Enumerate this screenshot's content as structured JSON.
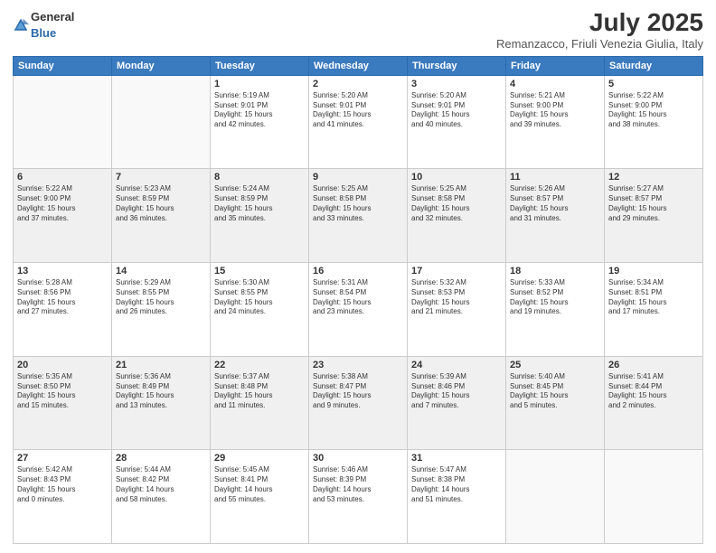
{
  "logo": {
    "general": "General",
    "blue": "Blue"
  },
  "header": {
    "month": "July 2025",
    "location": "Remanzacco, Friuli Venezia Giulia, Italy"
  },
  "weekdays": [
    "Sunday",
    "Monday",
    "Tuesday",
    "Wednesday",
    "Thursday",
    "Friday",
    "Saturday"
  ],
  "weeks": [
    [
      {
        "day": "",
        "info": ""
      },
      {
        "day": "",
        "info": ""
      },
      {
        "day": "1",
        "info": "Sunrise: 5:19 AM\nSunset: 9:01 PM\nDaylight: 15 hours\nand 42 minutes."
      },
      {
        "day": "2",
        "info": "Sunrise: 5:20 AM\nSunset: 9:01 PM\nDaylight: 15 hours\nand 41 minutes."
      },
      {
        "day": "3",
        "info": "Sunrise: 5:20 AM\nSunset: 9:01 PM\nDaylight: 15 hours\nand 40 minutes."
      },
      {
        "day": "4",
        "info": "Sunrise: 5:21 AM\nSunset: 9:00 PM\nDaylight: 15 hours\nand 39 minutes."
      },
      {
        "day": "5",
        "info": "Sunrise: 5:22 AM\nSunset: 9:00 PM\nDaylight: 15 hours\nand 38 minutes."
      }
    ],
    [
      {
        "day": "6",
        "info": "Sunrise: 5:22 AM\nSunset: 9:00 PM\nDaylight: 15 hours\nand 37 minutes."
      },
      {
        "day": "7",
        "info": "Sunrise: 5:23 AM\nSunset: 8:59 PM\nDaylight: 15 hours\nand 36 minutes."
      },
      {
        "day": "8",
        "info": "Sunrise: 5:24 AM\nSunset: 8:59 PM\nDaylight: 15 hours\nand 35 minutes."
      },
      {
        "day": "9",
        "info": "Sunrise: 5:25 AM\nSunset: 8:58 PM\nDaylight: 15 hours\nand 33 minutes."
      },
      {
        "day": "10",
        "info": "Sunrise: 5:25 AM\nSunset: 8:58 PM\nDaylight: 15 hours\nand 32 minutes."
      },
      {
        "day": "11",
        "info": "Sunrise: 5:26 AM\nSunset: 8:57 PM\nDaylight: 15 hours\nand 31 minutes."
      },
      {
        "day": "12",
        "info": "Sunrise: 5:27 AM\nSunset: 8:57 PM\nDaylight: 15 hours\nand 29 minutes."
      }
    ],
    [
      {
        "day": "13",
        "info": "Sunrise: 5:28 AM\nSunset: 8:56 PM\nDaylight: 15 hours\nand 27 minutes."
      },
      {
        "day": "14",
        "info": "Sunrise: 5:29 AM\nSunset: 8:55 PM\nDaylight: 15 hours\nand 26 minutes."
      },
      {
        "day": "15",
        "info": "Sunrise: 5:30 AM\nSunset: 8:55 PM\nDaylight: 15 hours\nand 24 minutes."
      },
      {
        "day": "16",
        "info": "Sunrise: 5:31 AM\nSunset: 8:54 PM\nDaylight: 15 hours\nand 23 minutes."
      },
      {
        "day": "17",
        "info": "Sunrise: 5:32 AM\nSunset: 8:53 PM\nDaylight: 15 hours\nand 21 minutes."
      },
      {
        "day": "18",
        "info": "Sunrise: 5:33 AM\nSunset: 8:52 PM\nDaylight: 15 hours\nand 19 minutes."
      },
      {
        "day": "19",
        "info": "Sunrise: 5:34 AM\nSunset: 8:51 PM\nDaylight: 15 hours\nand 17 minutes."
      }
    ],
    [
      {
        "day": "20",
        "info": "Sunrise: 5:35 AM\nSunset: 8:50 PM\nDaylight: 15 hours\nand 15 minutes."
      },
      {
        "day": "21",
        "info": "Sunrise: 5:36 AM\nSunset: 8:49 PM\nDaylight: 15 hours\nand 13 minutes."
      },
      {
        "day": "22",
        "info": "Sunrise: 5:37 AM\nSunset: 8:48 PM\nDaylight: 15 hours\nand 11 minutes."
      },
      {
        "day": "23",
        "info": "Sunrise: 5:38 AM\nSunset: 8:47 PM\nDaylight: 15 hours\nand 9 minutes."
      },
      {
        "day": "24",
        "info": "Sunrise: 5:39 AM\nSunset: 8:46 PM\nDaylight: 15 hours\nand 7 minutes."
      },
      {
        "day": "25",
        "info": "Sunrise: 5:40 AM\nSunset: 8:45 PM\nDaylight: 15 hours\nand 5 minutes."
      },
      {
        "day": "26",
        "info": "Sunrise: 5:41 AM\nSunset: 8:44 PM\nDaylight: 15 hours\nand 2 minutes."
      }
    ],
    [
      {
        "day": "27",
        "info": "Sunrise: 5:42 AM\nSunset: 8:43 PM\nDaylight: 15 hours\nand 0 minutes."
      },
      {
        "day": "28",
        "info": "Sunrise: 5:44 AM\nSunset: 8:42 PM\nDaylight: 14 hours\nand 58 minutes."
      },
      {
        "day": "29",
        "info": "Sunrise: 5:45 AM\nSunset: 8:41 PM\nDaylight: 14 hours\nand 55 minutes."
      },
      {
        "day": "30",
        "info": "Sunrise: 5:46 AM\nSunset: 8:39 PM\nDaylight: 14 hours\nand 53 minutes."
      },
      {
        "day": "31",
        "info": "Sunrise: 5:47 AM\nSunset: 8:38 PM\nDaylight: 14 hours\nand 51 minutes."
      },
      {
        "day": "",
        "info": ""
      },
      {
        "day": "",
        "info": ""
      }
    ]
  ]
}
